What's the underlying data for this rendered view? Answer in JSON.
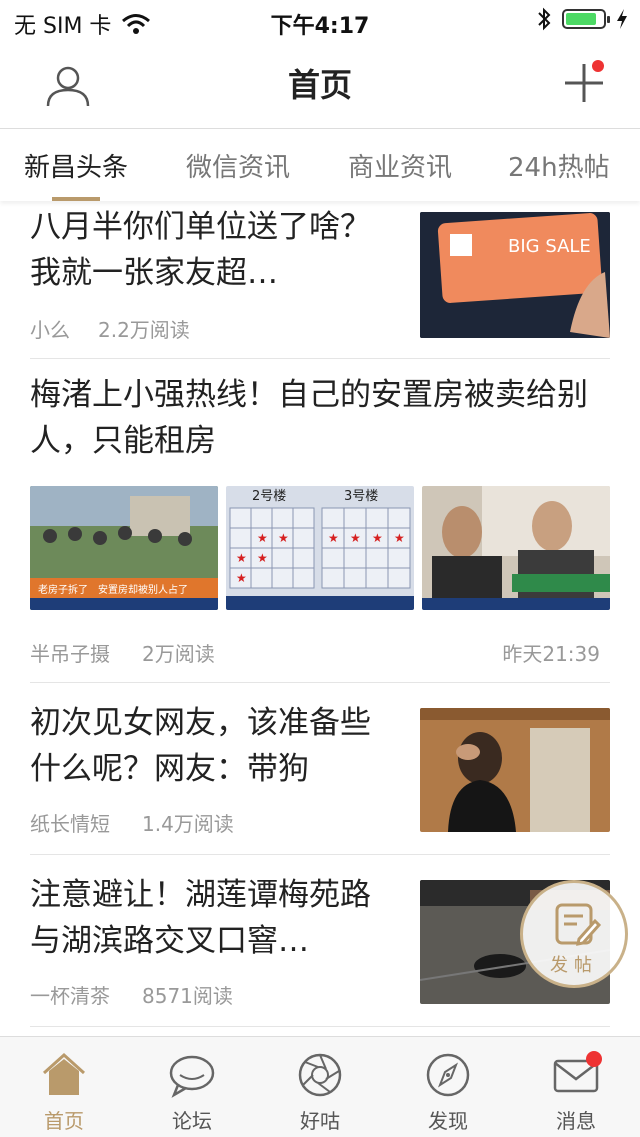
{
  "status_bar": {
    "carrier": "无 SIM 卡",
    "time": "下午4:17"
  },
  "nav": {
    "title": "首页"
  },
  "tabs": [
    {
      "label": "新昌头条",
      "active": true
    },
    {
      "label": "微信资讯",
      "active": false
    },
    {
      "label": "商业资讯",
      "active": false
    },
    {
      "label": "24h热帖",
      "active": false
    }
  ],
  "articles": [
    {
      "title": "八月半你们单位送了啥？我就一张家友超…",
      "author": "小么",
      "reads": "2.2万阅读",
      "thumb_caption": "BIG SALE"
    },
    {
      "title": "梅渚上小强热线！自己的安置房被卖给别人，只能租房",
      "author": "半吊子摄",
      "reads": "2万阅读",
      "time": "昨天21:39",
      "image_captions": [
        "老房子拆了　安置房却被别人占了",
        "2号楼",
        "3号楼"
      ]
    },
    {
      "title": "初次见女网友，该准备些什么呢？网友：带狗",
      "author": "纸长情短",
      "reads": "1.4万阅读"
    },
    {
      "title": "注意避让！湖莲谭梅苑路与湖滨路交叉口窨…",
      "author": "一杯清茶",
      "reads": "8571阅读"
    }
  ],
  "fab": {
    "label": "发帖"
  },
  "tabbar": [
    {
      "label": "首页",
      "icon": "home-icon",
      "active": true
    },
    {
      "label": "论坛",
      "icon": "chat-bubble-icon",
      "active": false
    },
    {
      "label": "好咕",
      "icon": "aperture-icon",
      "active": false
    },
    {
      "label": "发现",
      "icon": "compass-icon",
      "active": false
    },
    {
      "label": "消息",
      "icon": "mail-icon",
      "active": false
    }
  ],
  "colors": {
    "accent": "#b99a6b",
    "badge": "#e33333",
    "battery": "#4cd964"
  }
}
